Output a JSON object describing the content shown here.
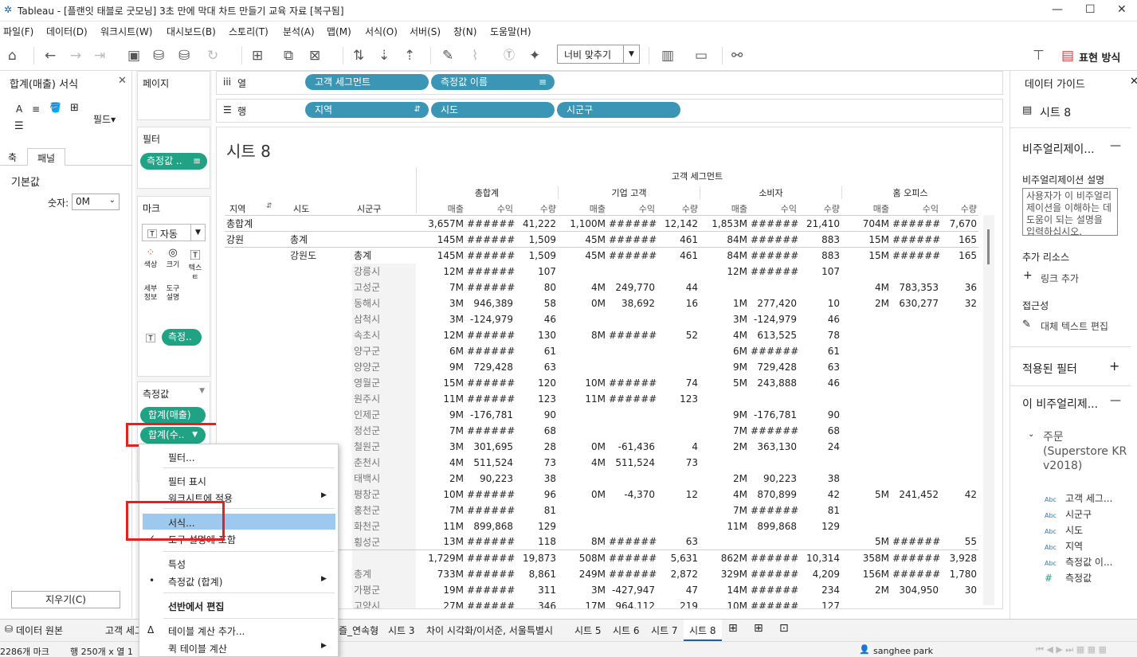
{
  "window": {
    "title": "Tableau - [플랜잇 태블로 굿모닝] 3초 만에 막대 차트 만들기 교육 자료 [복구됨]",
    "min": "—",
    "max": "☐",
    "close": "✕"
  },
  "menu": [
    "파일(F)",
    "데이터(D)",
    "워크시트(W)",
    "대시보드(B)",
    "스토리(T)",
    "분석(A)",
    "맵(M)",
    "서식(O)",
    "서버(S)",
    "창(N)",
    "도움말(H)"
  ],
  "toolbar": {
    "fit_label": "너비 맞추기",
    "show_me": "표현 방식"
  },
  "left_pane": {
    "title": "합계(매출) 서식",
    "tools": [
      "A",
      "≡",
      "🪣",
      "⊞"
    ],
    "field_label": "필드▾",
    "tabs": [
      "축",
      "패널"
    ],
    "section": "기본값",
    "numbers_label": "숫자:",
    "numbers_value": "0M",
    "clear_button": "지우기(C)"
  },
  "cards": {
    "pages": "페이지",
    "filters": "필터",
    "filter_pill": "측정값 ..",
    "marks": "마크",
    "mark_type": "자동",
    "mark_buttons": [
      "색상",
      "크기",
      "텍스트",
      "세부 정보",
      "도구 설명"
    ],
    "mark_text_pill": "측정..",
    "measure_values": "측정값",
    "mv_pills": [
      "합계(매출)",
      "합계(수.."
    ]
  },
  "shelves": {
    "columns_label": "열",
    "rows_label": "행",
    "columns": [
      "고객 세그먼트",
      "측정값 이름"
    ],
    "rows": [
      "지역",
      "시도",
      "시군구"
    ]
  },
  "sheet": {
    "title": "시트 8",
    "segment_header": "고객 세그먼트",
    "row_headers": [
      "지역",
      "시도",
      "시군구"
    ],
    "segments": [
      "총합계",
      "기업 고객",
      "소비자",
      "홈 오피스"
    ],
    "measures": [
      "매출",
      "수익",
      "수량"
    ],
    "rows": [
      [
        "총합계",
        "",
        "",
        "3,657M",
        "######",
        "41,222",
        "1,100M",
        "######",
        "12,142",
        "1,853M",
        "######",
        "21,410",
        "704M",
        "######",
        "7,670"
      ],
      [
        "강원",
        "총계",
        "",
        "145M",
        "######",
        "1,509",
        "45M",
        "######",
        "461",
        "84M",
        "######",
        "883",
        "15M",
        "######",
        "165"
      ],
      [
        "",
        "강원도",
        "총계",
        "145M",
        "######",
        "1,509",
        "45M",
        "######",
        "461",
        "84M",
        "######",
        "883",
        "15M",
        "######",
        "165"
      ],
      [
        "",
        "",
        "강릉시",
        "12M",
        "######",
        "107",
        "",
        "",
        "",
        "12M",
        "######",
        "107",
        "",
        "",
        ""
      ],
      [
        "",
        "",
        "고성군",
        "7M",
        "######",
        "80",
        "4M",
        "249,770",
        "44",
        "",
        "",
        "",
        "4M",
        "783,353",
        "36"
      ],
      [
        "",
        "",
        "동해시",
        "3M",
        "946,389",
        "58",
        "0M",
        "38,692",
        "16",
        "1M",
        "277,420",
        "10",
        "2M",
        "630,277",
        "32"
      ],
      [
        "",
        "",
        "삼척시",
        "3M",
        "-124,979",
        "46",
        "",
        "",
        "",
        "3M",
        "-124,979",
        "46",
        "",
        "",
        ""
      ],
      [
        "",
        "",
        "속초시",
        "12M",
        "######",
        "130",
        "8M",
        "######",
        "52",
        "4M",
        "613,525",
        "78",
        "",
        "",
        ""
      ],
      [
        "",
        "",
        "양구군",
        "6M",
        "######",
        "61",
        "",
        "",
        "",
        "6M",
        "######",
        "61",
        "",
        "",
        ""
      ],
      [
        "",
        "",
        "양양군",
        "9M",
        "729,428",
        "63",
        "",
        "",
        "",
        "9M",
        "729,428",
        "63",
        "",
        "",
        ""
      ],
      [
        "",
        "",
        "영월군",
        "15M",
        "######",
        "120",
        "10M",
        "######",
        "74",
        "5M",
        "243,888",
        "46",
        "",
        "",
        ""
      ],
      [
        "",
        "",
        "원주시",
        "11M",
        "######",
        "123",
        "11M",
        "######",
        "123",
        "",
        "",
        "",
        "",
        "",
        ""
      ],
      [
        "",
        "",
        "인제군",
        "9M",
        "-176,781",
        "90",
        "",
        "",
        "",
        "9M",
        "-176,781",
        "90",
        "",
        "",
        ""
      ],
      [
        "",
        "",
        "정선군",
        "7M",
        "######",
        "68",
        "",
        "",
        "",
        "7M",
        "######",
        "68",
        "",
        "",
        ""
      ],
      [
        "",
        "",
        "철원군",
        "3M",
        "301,695",
        "28",
        "0M",
        "-61,436",
        "4",
        "2M",
        "363,130",
        "24",
        "",
        "",
        ""
      ],
      [
        "",
        "",
        "춘천시",
        "4M",
        "511,524",
        "73",
        "4M",
        "511,524",
        "73",
        "",
        "",
        "",
        "",
        "",
        ""
      ],
      [
        "",
        "",
        "태백시",
        "2M",
        "90,223",
        "38",
        "",
        "",
        "",
        "2M",
        "90,223",
        "38",
        "",
        "",
        ""
      ],
      [
        "",
        "",
        "평창군",
        "10M",
        "######",
        "96",
        "0M",
        "-4,370",
        "12",
        "4M",
        "870,899",
        "42",
        "5M",
        "241,452",
        "42"
      ],
      [
        "",
        "",
        "홍천군",
        "7M",
        "######",
        "81",
        "",
        "",
        "",
        "7M",
        "######",
        "81",
        "",
        "",
        ""
      ],
      [
        "",
        "",
        "화천군",
        "11M",
        "899,868",
        "129",
        "",
        "",
        "",
        "11M",
        "899,868",
        "129",
        "",
        "",
        ""
      ],
      [
        "",
        "",
        "횡성군",
        "13M",
        "######",
        "118",
        "8M",
        "######",
        "63",
        "",
        "",
        "",
        "5M",
        "######",
        "55"
      ],
      [
        "",
        "",
        "",
        "1,729M",
        "######",
        "19,873",
        "508M",
        "######",
        "5,631",
        "862M",
        "######",
        "10,314",
        "358M",
        "######",
        "3,928"
      ],
      [
        "",
        "",
        "총계",
        "733M",
        "######",
        "8,861",
        "249M",
        "######",
        "2,872",
        "329M",
        "######",
        "4,209",
        "156M",
        "######",
        "1,780"
      ],
      [
        "",
        "",
        "가평군",
        "19M",
        "######",
        "311",
        "3M",
        "-427,947",
        "47",
        "14M",
        "######",
        "234",
        "2M",
        "304,950",
        "30"
      ],
      [
        "",
        "",
        "고양시",
        "27M",
        "######",
        "346",
        "17M",
        "964,112",
        "219",
        "10M",
        "######",
        "127",
        "",
        "",
        ""
      ]
    ]
  },
  "right_pane": {
    "title": "데이터 가이드",
    "sheet": "시트 8",
    "section1": "비주얼리제이...",
    "desc_label": "비주얼리제이션 설명",
    "desc_placeholder": "사용자가 이 비주얼리제이션을 이해하는 데 도움이 되는 설명을 입력하십시오.",
    "resources": "추가 리소스",
    "add_link": "링크 추가",
    "accessibility": "접근성",
    "alt_text": "대체 텍스트 편집",
    "applied_filters": "적용된 필터",
    "this_viz": "이 비주얼리제...",
    "datasource": "주문 (Superstore KR v2018)",
    "fields": [
      "고객 세그...",
      "시군구",
      "시도",
      "지역",
      "측정값 이...",
      "측정값"
    ],
    "field_types": [
      "Abc",
      "Abc",
      "Abc",
      "Abc",
      "Abc",
      "#"
    ]
  },
  "context_menu": {
    "items": [
      "필터...",
      "필터 표시",
      "워크시트에 적용",
      "서식...",
      "도구 설명에 포함",
      "특성",
      "측정값 (합계)",
      "선반에서 편집",
      "테이블 계산 추가...",
      "퀵 테이블 계산"
    ]
  },
  "bottom": {
    "datasource_tab": "데이터 원본",
    "tabs": [
      "고객 세그",
      "즐_연속형",
      "시트 3",
      "차이 시각화/이서준, 서울특별시",
      "시트 5",
      "시트 6",
      "시트 7",
      "시트 8"
    ],
    "status_marks": "2286개 마크",
    "status_rows": "행 250개 x 열 12",
    "user": "sanghee park"
  }
}
